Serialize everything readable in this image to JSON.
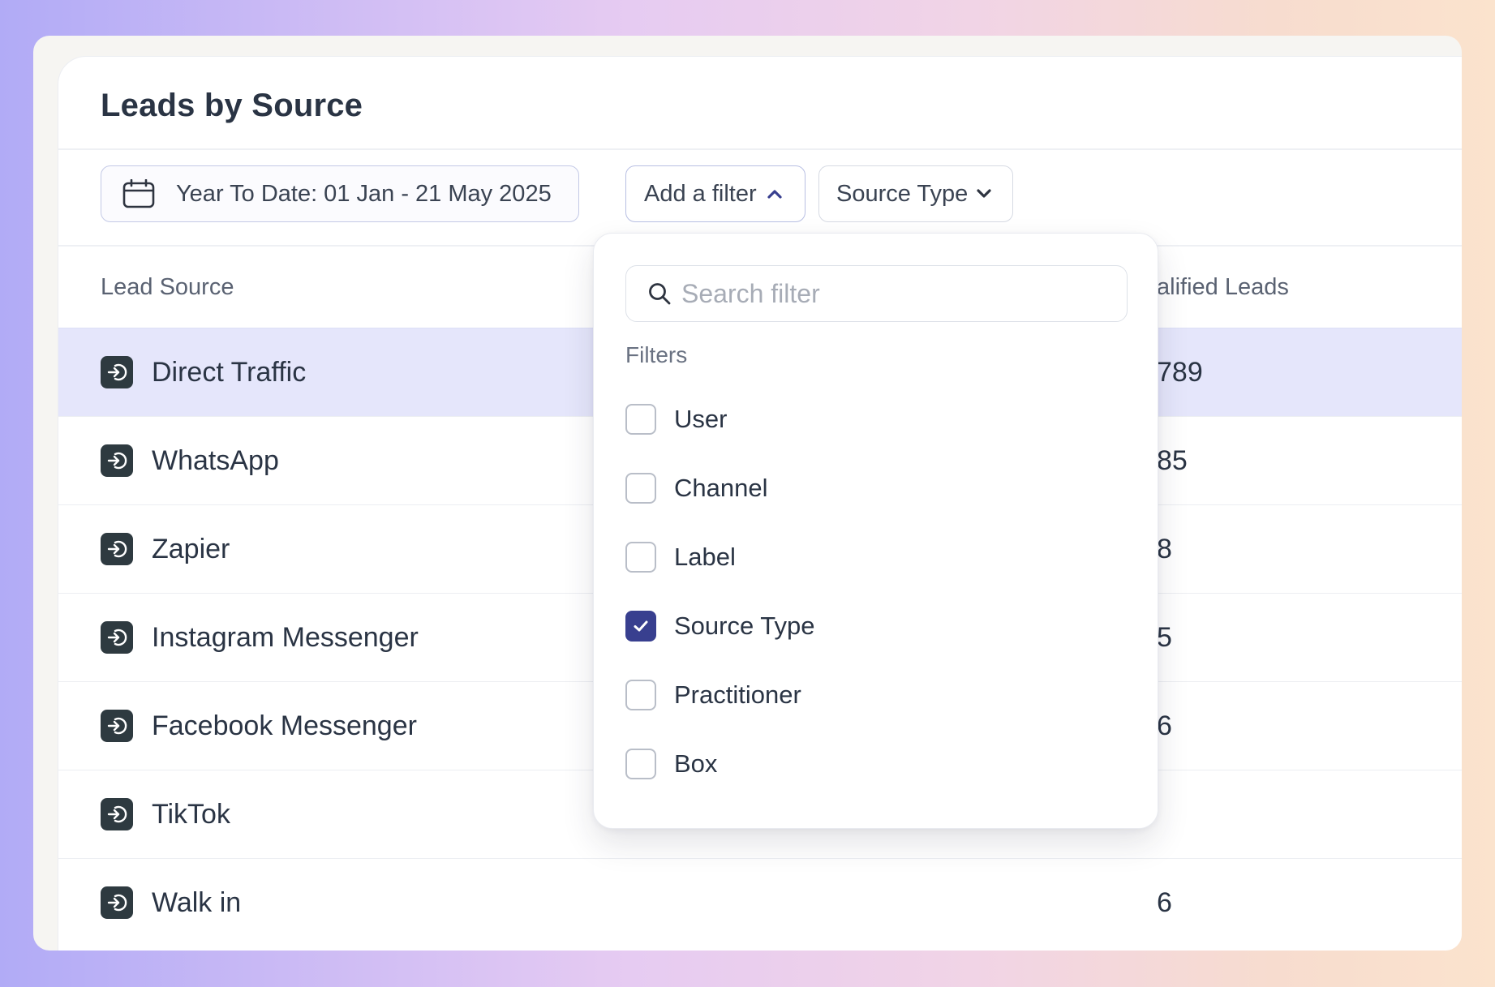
{
  "page": {
    "title": "Leads by Source"
  },
  "toolbar": {
    "date_range": "Year To Date: 01 Jan - 21 May 2025",
    "add_filter_label": "Add a filter",
    "source_type_label": "Source Type"
  },
  "table": {
    "columns": [
      "Lead Source",
      "alified Leads"
    ],
    "rows": [
      {
        "source": "Direct Traffic",
        "qualified": "789",
        "icon": "login-arrow-icon",
        "highlighted": true
      },
      {
        "source": "WhatsApp",
        "qualified": "85",
        "icon": "login-arrow-icon"
      },
      {
        "source": "Zapier",
        "qualified": "8",
        "icon": "login-arrow-icon"
      },
      {
        "source": "Instagram Messenger",
        "qualified": "5",
        "icon": "login-arrow-icon"
      },
      {
        "source": "Facebook Messenger",
        "qualified": "6",
        "icon": "login-arrow-icon"
      },
      {
        "source": "TikTok",
        "qualified": "",
        "icon": "login-arrow-icon"
      },
      {
        "source": "Walk in",
        "qualified": "6",
        "icon": "login-arrow-icon"
      }
    ]
  },
  "dropdown": {
    "search_placeholder": "Search filter",
    "search_value": "",
    "section_label": "Filters",
    "options": [
      {
        "label": "User",
        "checked": false
      },
      {
        "label": "Channel",
        "checked": false
      },
      {
        "label": "Label",
        "checked": false
      },
      {
        "label": "Source Type",
        "checked": true
      },
      {
        "label": "Practitioner",
        "checked": false
      },
      {
        "label": "Box",
        "checked": false
      }
    ]
  },
  "colors": {
    "accent": "#383f8f",
    "highlight_row": "#e5e6fb",
    "icon_bg": "#2e3a40"
  }
}
